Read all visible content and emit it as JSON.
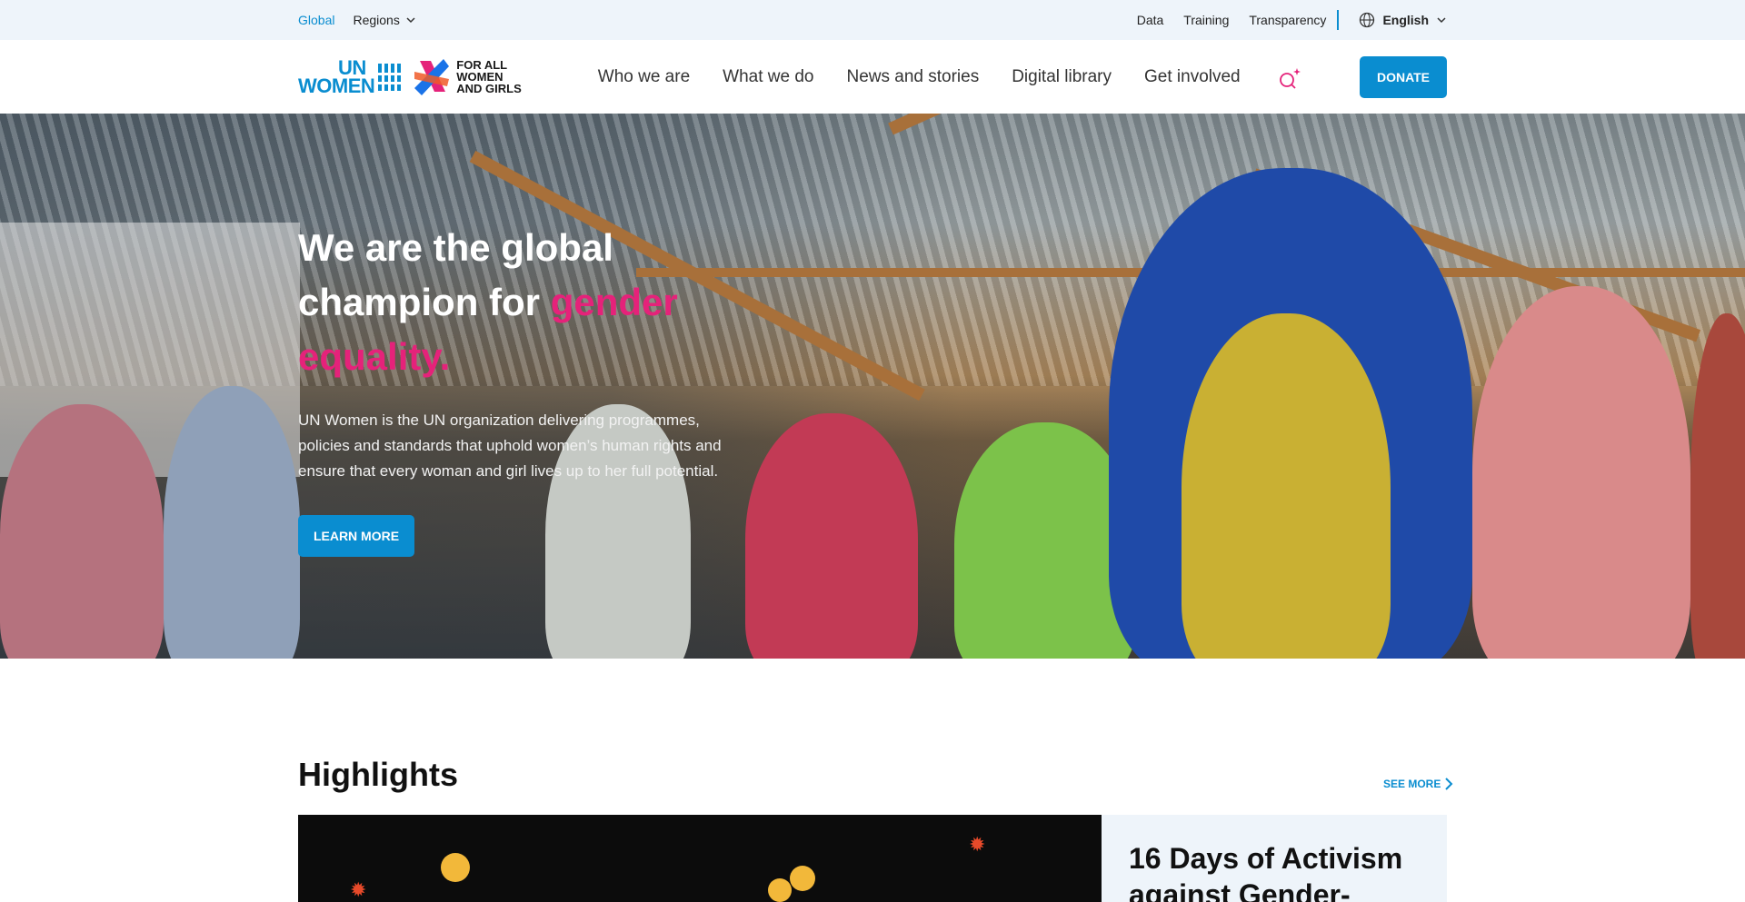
{
  "utility": {
    "global_label": "Global",
    "regions_label": "Regions",
    "links": [
      "Data",
      "Training",
      "Transparency"
    ],
    "language": "English"
  },
  "header": {
    "logo": {
      "un_line1": "UN",
      "un_line2": "WOMEN",
      "tagline_line1": "FOR ALL",
      "tagline_line2": "WOMEN",
      "tagline_line3": "AND GIRLS"
    },
    "nav": [
      "Who we are",
      "What we do",
      "News and stories",
      "Digital library",
      "Get involved"
    ],
    "donate_label": "DONATE"
  },
  "hero": {
    "headline_start": "We are the global champion for ",
    "headline_highlight": "gender equality.",
    "description": "UN Women is the UN organization delivering programmes, policies and standards that uphold women’s human rights and ensure that every woman and girl lives up to her full potential.",
    "cta_label": "LEARN MORE"
  },
  "highlights": {
    "title": "Highlights",
    "see_more_label": "SEE MORE",
    "featured_title": "16 Days of Activism against Gender-"
  },
  "colors": {
    "brand_blue": "#0a8dd0",
    "accent_pink": "#e5227a",
    "utility_bg": "#eef4fa"
  },
  "icons": [
    "chevron-down-icon",
    "globe-icon",
    "search-icon",
    "chevron-right-icon"
  ]
}
